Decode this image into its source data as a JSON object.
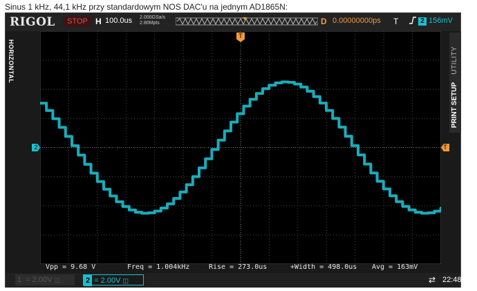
{
  "caption": "Sinus 1 kHz, 44,1 kHz przy standardowym NOS DAC'u na jednym AD1865N:",
  "topbar": {
    "brand": "RIGOL",
    "run_state": "STOP",
    "h_label": "H",
    "timebase": "100.0us",
    "sample_rate": "2.000GSa/s",
    "memory_depth": "2.80Mpts",
    "delay_label": "D",
    "delay_value": "0.00000000ps",
    "trigger_label": "T",
    "trigger_edge_icon": "rising-edge-icon",
    "trigger_channel": "2",
    "trigger_level": "156mV"
  },
  "side": {
    "left_tab": "HORIZONTAL",
    "right_tab_top": "UTILITY",
    "right_tab_bottom": "PRINT SETUP"
  },
  "markers": {
    "trigger_position": "T",
    "channel_ground": "2",
    "trigger_level_marker": "T"
  },
  "measurements": {
    "vpp": "Vpp = 9.68 V",
    "freq": "Freq = 1.004kHz",
    "rise": "Rise = 273.0us",
    "width": "+Width = 498.0us",
    "avg": "Avg = 163mV"
  },
  "channels": [
    {
      "number": "1",
      "scale": "= 2.00V",
      "active": false
    },
    {
      "number": "2",
      "scale": "= 2.00V",
      "active": true
    }
  ],
  "status": {
    "usb_icon": "usb-icon",
    "time": "22:48"
  },
  "colors": {
    "trace": "#1bc0d0",
    "trigger": "#f29a3c",
    "stop": "#e24a4a",
    "grid": "#4a4a4a"
  }
}
